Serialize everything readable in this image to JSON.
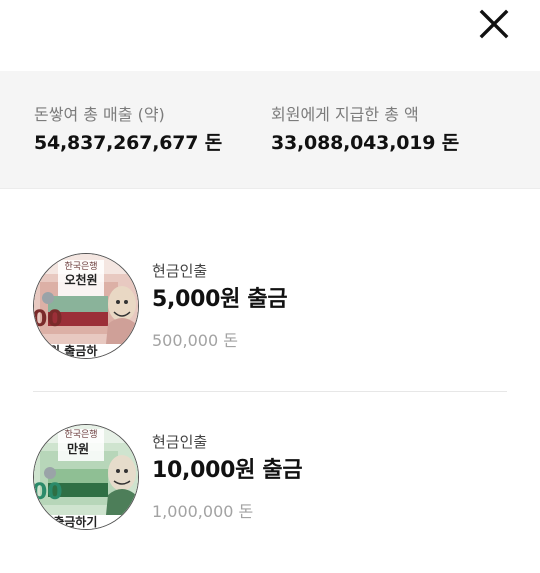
{
  "header": {
    "close_icon": "close-icon"
  },
  "stats": {
    "total_sales_label": "돈쌓여 총 매출 (약)",
    "total_sales_value": "54,837,267,677 돈",
    "total_paid_label": "회원에게 지급한 총 액",
    "total_paid_value": "33,088,043,019 돈"
  },
  "items": [
    {
      "category": "현금인출",
      "title": "5,000원 출금",
      "price": "500,000 돈",
      "note": {
        "bank": "한국은행",
        "name": "오천원",
        "digits": "00",
        "caption": "천원 출금하",
        "color": "#d98a86"
      }
    },
    {
      "category": "현금인출",
      "title": "10,000원 출금",
      "price": "1,000,000 돈",
      "note": {
        "bank": "한국은행",
        "name": "만원",
        "digits": "00",
        "caption": "원 출금하기",
        "color": "#7fb083"
      }
    }
  ]
}
